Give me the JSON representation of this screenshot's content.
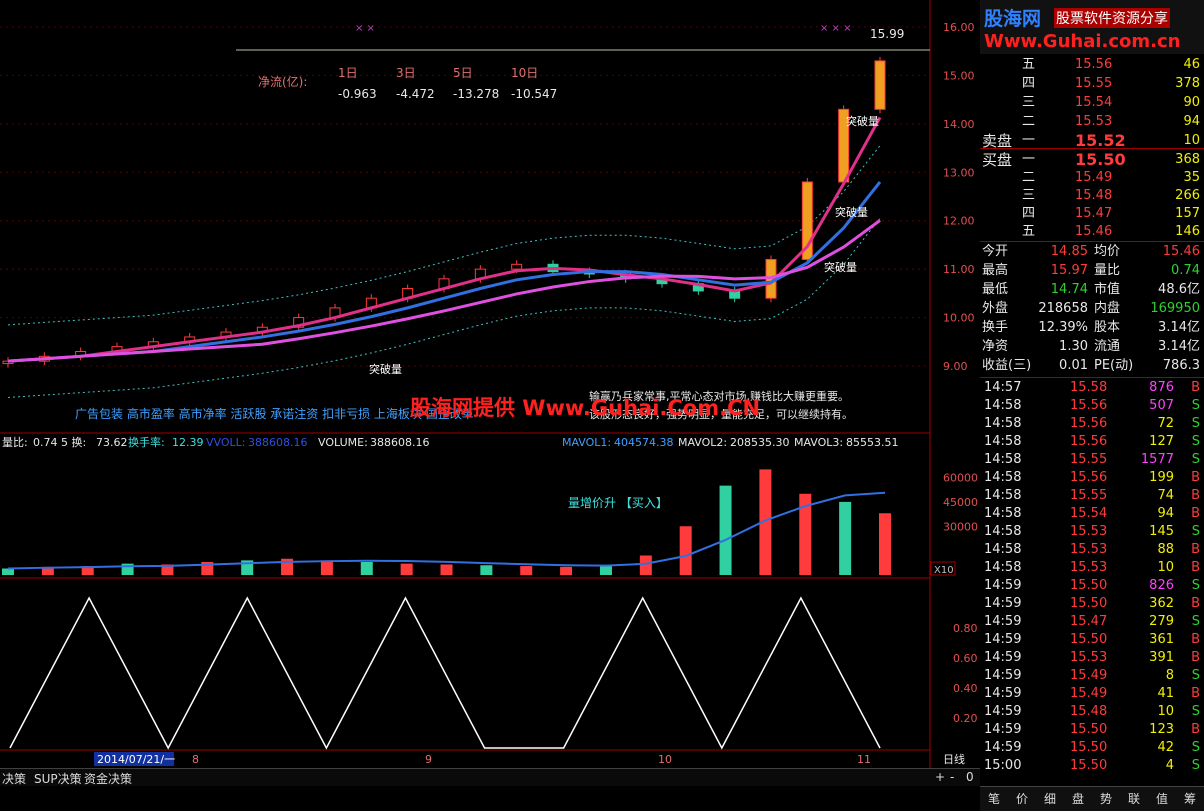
{
  "logo": {
    "title": "股海网",
    "slogan": "股票软件资源分享",
    "url": "Www.Guhai.com.cn"
  },
  "order_book": {
    "sell": [
      {
        "label": "五",
        "price": "15.56",
        "vol": "46"
      },
      {
        "label": "四",
        "price": "15.55",
        "vol": "378"
      },
      {
        "label": "三",
        "price": "15.54",
        "vol": "90"
      },
      {
        "label": "二",
        "price": "15.53",
        "vol": "94"
      },
      {
        "label": "一",
        "price": "15.52",
        "vol": "10",
        "prefix": "卖盘"
      }
    ],
    "buy": [
      {
        "label": "一",
        "price": "15.50",
        "vol": "368",
        "prefix": "买盘"
      },
      {
        "label": "二",
        "price": "15.49",
        "vol": "35"
      },
      {
        "label": "三",
        "price": "15.48",
        "vol": "266"
      },
      {
        "label": "四",
        "price": "15.47",
        "vol": "157"
      },
      {
        "label": "五",
        "price": "15.46",
        "vol": "146"
      }
    ]
  },
  "stats": [
    {
      "l1": "今开",
      "v1": "14.85",
      "l2": "均价",
      "v2": "15.46"
    },
    {
      "l1": "最高",
      "v1": "15.97",
      "l2": "量比",
      "v2": "0.74"
    },
    {
      "l1": "最低",
      "v1": "14.74",
      "l2": "市值",
      "v2": "48.6亿"
    },
    {
      "l1": "外盘",
      "v1": "218658",
      "l2": "内盘",
      "v2": "169950"
    },
    {
      "l1": "换手",
      "v1": "12.39%",
      "l2": "股本",
      "v2": "3.14亿"
    },
    {
      "l1": "净资",
      "v1": "1.30",
      "l2": "流通",
      "v2": "3.14亿"
    },
    {
      "l1": "收益(三)",
      "v1": "0.01",
      "l2": "PE(动)",
      "v2": "786.3"
    }
  ],
  "ticks": [
    {
      "time": "14:57",
      "price": "15.58",
      "vol": "876",
      "side": "B"
    },
    {
      "time": "14:58",
      "price": "15.56",
      "vol": "507",
      "side": "S"
    },
    {
      "time": "14:58",
      "price": "15.56",
      "vol": "72",
      "side": "S"
    },
    {
      "time": "14:58",
      "price": "15.56",
      "vol": "127",
      "side": "S"
    },
    {
      "time": "14:58",
      "price": "15.55",
      "vol": "1577",
      "side": "S"
    },
    {
      "time": "14:58",
      "price": "15.56",
      "vol": "199",
      "side": "B"
    },
    {
      "time": "14:58",
      "price": "15.55",
      "vol": "74",
      "side": "B"
    },
    {
      "time": "14:58",
      "price": "15.54",
      "vol": "94",
      "side": "B"
    },
    {
      "time": "14:58",
      "price": "15.53",
      "vol": "145",
      "side": "S"
    },
    {
      "time": "14:58",
      "price": "15.53",
      "vol": "88",
      "side": "B"
    },
    {
      "time": "14:58",
      "price": "15.53",
      "vol": "10",
      "side": "B"
    },
    {
      "time": "14:59",
      "price": "15.50",
      "vol": "826",
      "side": "S"
    },
    {
      "time": "14:59",
      "price": "15.50",
      "vol": "362",
      "side": "B"
    },
    {
      "time": "14:59",
      "price": "15.47",
      "vol": "279",
      "side": "S"
    },
    {
      "time": "14:59",
      "price": "15.50",
      "vol": "361",
      "side": "B"
    },
    {
      "time": "14:59",
      "price": "15.53",
      "vol": "391",
      "side": "B"
    },
    {
      "time": "14:59",
      "price": "15.49",
      "vol": "8",
      "side": "S"
    },
    {
      "time": "14:59",
      "price": "15.49",
      "vol": "41",
      "side": "B"
    },
    {
      "time": "14:59",
      "price": "15.48",
      "vol": "10",
      "side": "S"
    },
    {
      "time": "14:59",
      "price": "15.50",
      "vol": "123",
      "side": "B"
    },
    {
      "time": "14:59",
      "price": "15.50",
      "vol": "42",
      "side": "S"
    },
    {
      "time": "15:00",
      "price": "15.50",
      "vol": "4",
      "side": "S"
    }
  ],
  "bottom_tabs": [
    "笔",
    "价",
    "细",
    "盘",
    "势",
    "联",
    "值",
    "筹"
  ],
  "main_chart": {
    "net_flow_label": "净流(亿):",
    "net_flow_periods": [
      "1日",
      "3日",
      "5日",
      "10日"
    ],
    "net_flow_values": [
      "-0.963",
      "-4.472",
      "-13.278",
      "-10.547"
    ],
    "max_price_label": "15.99",
    "breakout_label": "突破量",
    "price_axis": [
      "16.00",
      "15.00",
      "14.00",
      "13.00",
      "12.00",
      "11.00",
      "10.00",
      "9.00"
    ],
    "info_line1": "输赢乃兵家常事,平常心态对市场,赚钱比大赚更重要。",
    "info_line2": "该股形态良好，强势明显，量能充足，可以继续持有。",
    "tags": "广告包装 高市盈率 高市净率 活跃股 承诺注资 扣非亏损 上海板块 国企改革",
    "watermark": "股海网提供 Www.Guhai.Com.CN"
  },
  "volume_chart": {
    "header": [
      {
        "label": "量比:",
        "value": "0.74"
      },
      {
        "label": "5 换:",
        "value": "73.62"
      },
      {
        "label": "换手率:",
        "value": "12.39"
      },
      {
        "label": "VVOLL:",
        "value": "388608.16"
      },
      {
        "label": "VOLUME:",
        "value": "388608.16"
      },
      {
        "label": "MAVOL1:",
        "value": "404574.38"
      },
      {
        "label": "MAVOL2:",
        "value": "208535.30"
      },
      {
        "label": "MAVOL3:",
        "value": "85553.51"
      }
    ],
    "signal_text": "量增价升 【买入】",
    "axis": [
      "60000",
      "45000",
      "30000"
    ],
    "unit": "X10"
  },
  "signal_chart": {
    "axis": [
      "0.80",
      "0.60",
      "0.40",
      "0.20"
    ]
  },
  "time_axis": {
    "date": "2014/07/21/一",
    "months": [
      "8",
      "9",
      "10",
      "11"
    ],
    "period": "日线"
  },
  "bottom_tabs_left": [
    "决策",
    "SUP决策",
    "资金决策"
  ],
  "colors": {
    "up": "#ff3b3b",
    "down": "#30d0a0",
    "axis": "#a00000",
    "ma_pink": "#e0308a",
    "ma_blue": "#3070e0",
    "ma_magenta": "#e050e0"
  },
  "chart_data": [
    {
      "type": "line",
      "title": "",
      "price_range": [
        9,
        16.2
      ],
      "series": [
        {
          "name": "",
          "values": [
            9.1,
            9.2,
            9.3,
            9.4,
            9.5,
            9.6,
            9.7,
            9.8,
            10.0,
            10.2,
            10.4,
            10.6,
            10.8,
            11.0,
            11.1,
            10.95,
            10.9,
            10.8,
            10.7,
            10.55,
            10.4,
            11.2,
            12.8,
            14.3,
            15.3
          ]
        }
      ]
    },
    {
      "type": "bar",
      "title": "",
      "ylim": [
        0,
        72000
      ],
      "values": [
        4000,
        5000,
        5500,
        7000,
        6500,
        8000,
        9000,
        10000,
        9000,
        8000,
        7000,
        6500,
        6000,
        5500,
        5000,
        6000,
        12000,
        30000,
        55000,
        65000,
        50000,
        45000,
        38000
      ]
    },
    {
      "type": "line",
      "title": "",
      "ylim": [
        0,
        1
      ],
      "values": [
        0,
        1,
        0,
        1,
        0,
        1,
        0,
        0,
        1,
        0,
        1,
        0
      ]
    }
  ]
}
